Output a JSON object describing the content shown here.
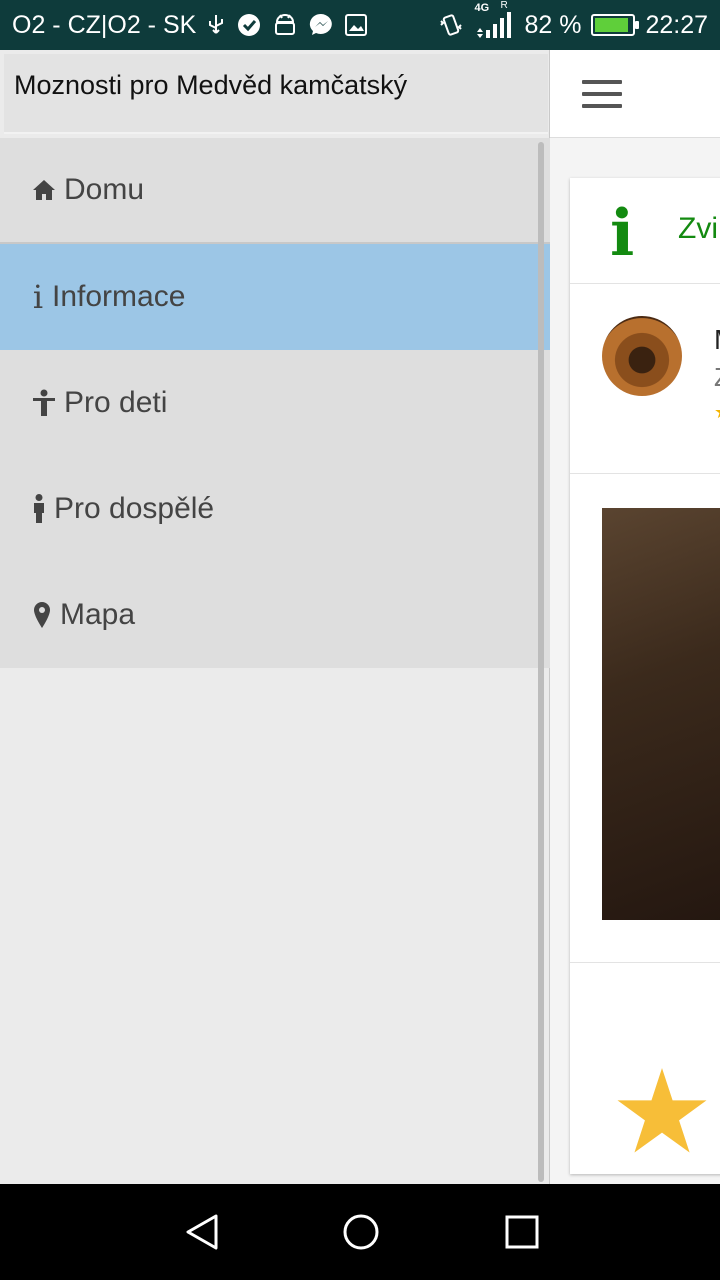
{
  "status_bar": {
    "carrier": "O2 - CZ|O2 - SK",
    "network": "4G",
    "roaming": "R",
    "battery_percent": "82 %",
    "time": "22:27",
    "icons": [
      "usb-icon",
      "check-shield-icon",
      "android-icon",
      "messenger-icon",
      "image-icon",
      "vibrate-icon",
      "signal-icon",
      "battery-icon"
    ]
  },
  "drawer": {
    "title": "Moznosti pro Medvěd kamčatský",
    "items": [
      {
        "label": "Domu",
        "icon": "home-icon"
      },
      {
        "label": "Informace",
        "icon": "info-icon"
      },
      {
        "label": "Pro deti",
        "icon": "child-icon"
      },
      {
        "label": "Pro dospělé",
        "icon": "adult-icon"
      },
      {
        "label": "Mapa",
        "icon": "map-marker-icon"
      }
    ],
    "active_index": 1
  },
  "content": {
    "header_title": "Zvi",
    "profile_line1": "M",
    "profile_line2": "Z",
    "info_icon_glyph": "i",
    "star_glyph": "★"
  },
  "colors": {
    "status_bar": "#0e3b3b",
    "drawer_bg": "#ebebeb",
    "menu_item_bg": "#dedede",
    "active_item_bg": "#9cc6e6",
    "accent_green": "#138a10",
    "star": "#f7be38"
  }
}
